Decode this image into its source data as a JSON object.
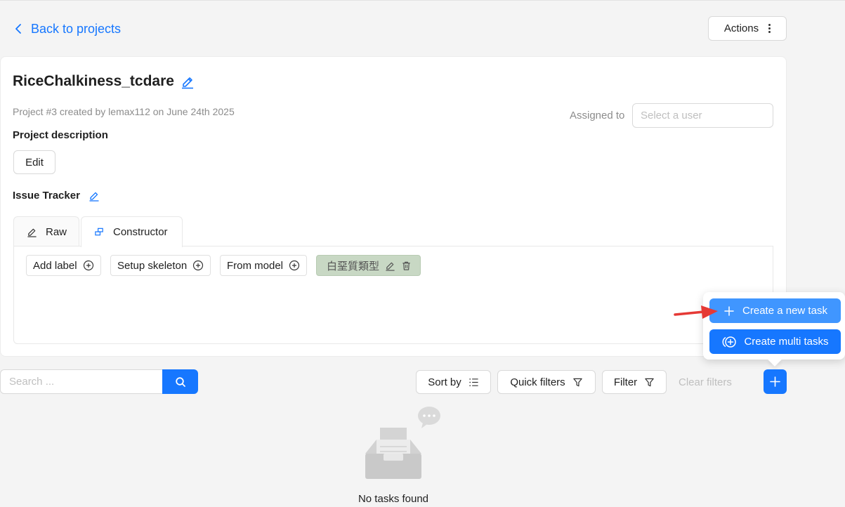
{
  "nav": {
    "back_label": "Back to projects",
    "actions_label": "Actions"
  },
  "project": {
    "title": "RiceChalkiness_tcdare",
    "meta": "Project #3 created by lemax112 on June 24th 2025",
    "assigned_label": "Assigned to",
    "assigned_placeholder": "Select a user",
    "description_label": "Project description",
    "edit_label": "Edit",
    "issue_tracker_label": "Issue Tracker"
  },
  "tabs": [
    {
      "label": "Raw",
      "icon": "pencil-icon",
      "active": false
    },
    {
      "label": "Constructor",
      "icon": "constructor-icon",
      "active": true
    }
  ],
  "constructor": {
    "add_label": "Add label",
    "setup_skeleton": "Setup skeleton",
    "from_model": "From model",
    "labels": [
      {
        "name": "白堊質類型",
        "color": "#c8d8c4"
      }
    ]
  },
  "create_menu": {
    "create_task": "Create a new task",
    "create_multi": "Create multi tasks"
  },
  "toolbar": {
    "search_placeholder": "Search ...",
    "sort_by": "Sort by",
    "quick_filters": "Quick filters",
    "filter": "Filter",
    "clear_filters": "Clear filters"
  },
  "empty": {
    "text": "No tasks found"
  },
  "colors": {
    "primary": "#1677ff",
    "primary_light": "#4096ff",
    "annotation_arrow": "#e53935"
  }
}
